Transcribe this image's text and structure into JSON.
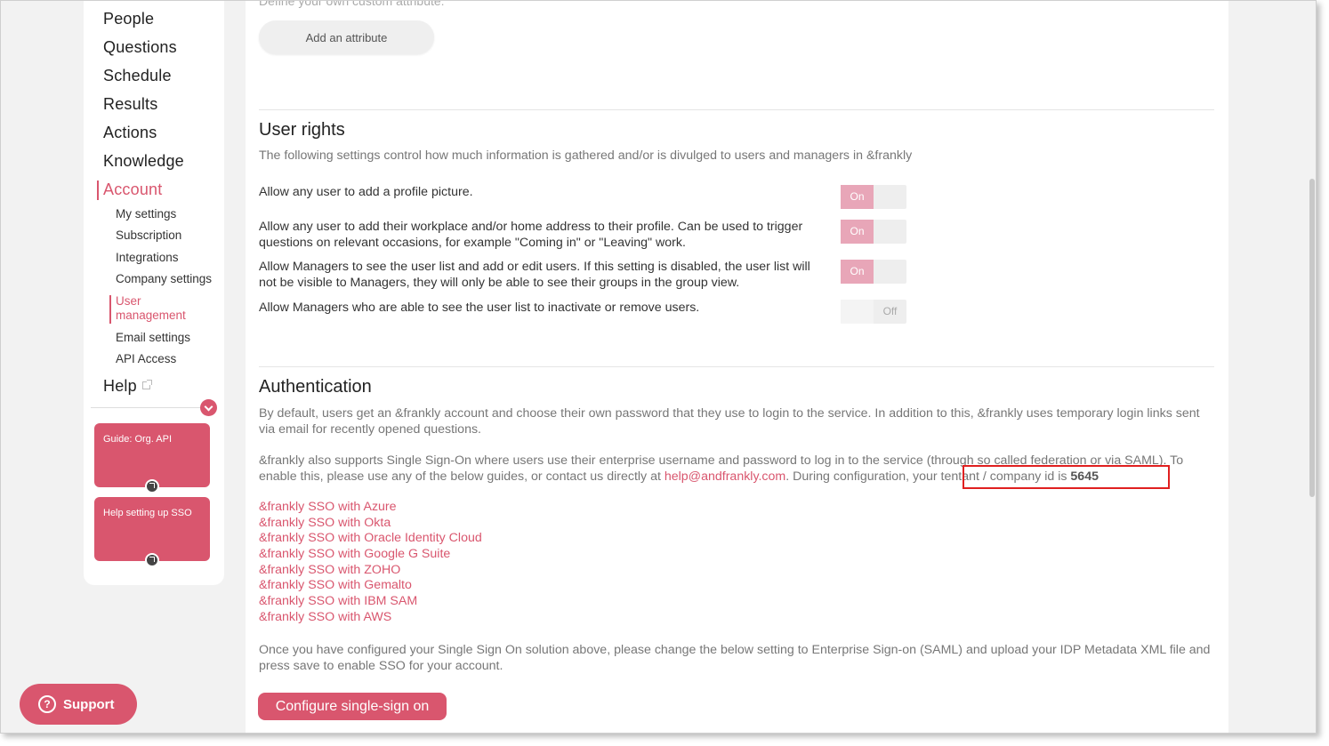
{
  "nav": {
    "items": [
      "People",
      "Questions",
      "Schedule",
      "Results",
      "Actions",
      "Knowledge",
      "Account"
    ],
    "account_sub": [
      "My settings",
      "Subscription",
      "Integrations",
      "Company settings",
      "User management",
      "Email settings",
      "API Access"
    ],
    "help": "Help"
  },
  "guides": [
    {
      "label": "Guide: Org. API"
    },
    {
      "label": "Help setting up SSO"
    }
  ],
  "support_label": "Support",
  "attributes": {
    "faded_text": "Define your own custom attribute:",
    "add_label": "Add an attribute"
  },
  "user_rights": {
    "title": "User rights",
    "description": "The following settings control how much information is gathered and/or is divulged to users and managers in &frankly",
    "settings": [
      {
        "label": "Allow any user to add a profile picture.",
        "state": "On"
      },
      {
        "label": "Allow any user to add their workplace and/or home address to their profile. Can be used to trigger questions on relevant occasions, for example \"Coming in\" or \"Leaving\" work.",
        "state": "On"
      },
      {
        "label": "Allow Managers to see the user list and add or edit users. If this setting is disabled, the user list will not be visible to Managers, they will only be able to see their groups in the group view.",
        "state": "On"
      },
      {
        "label": "Allow Managers who are able to see the user list to inactivate or remove users.",
        "state": "Off"
      }
    ]
  },
  "authentication": {
    "title": "Authentication",
    "para1": "By default, users get an &frankly account and choose their own password that they use to login to the service. In addition to this, &frankly uses temporary login links sent via email for recently opened questions.",
    "para2_start": "&frankly also supports Single Sign-On where users use their enterprise username and password to log in to the service (through so called federation or via SAML). To enable this, please use any of the below guides, or contact us directly at ",
    "email": "help@andfrankly.com",
    "para2_mid": ". During configuration, ",
    "tenant_text": "your tentant / company id is ",
    "tenant_id": "5645",
    "links": [
      "&frankly SSO with Azure",
      "&frankly SSO with Okta",
      "&frankly SSO with Oracle Identity Cloud",
      "&frankly SSO with Google G Suite",
      "&frankly SSO with ZOHO",
      "&frankly SSO with Gemalto",
      "&frankly SSO with IBM SAM",
      "&frankly SSO with AWS"
    ],
    "para3": "Once you have configured your Single Sign On solution above, please change the below setting to Enterprise Sign-on (SAML) and upload your IDP Metadata XML file and press save to enable SSO for your account.",
    "configure_label": "Configure single-sign on"
  },
  "colors": {
    "accent": "#d9566e",
    "toggle_on": "#e8a6b8",
    "highlight": "#e02020"
  }
}
